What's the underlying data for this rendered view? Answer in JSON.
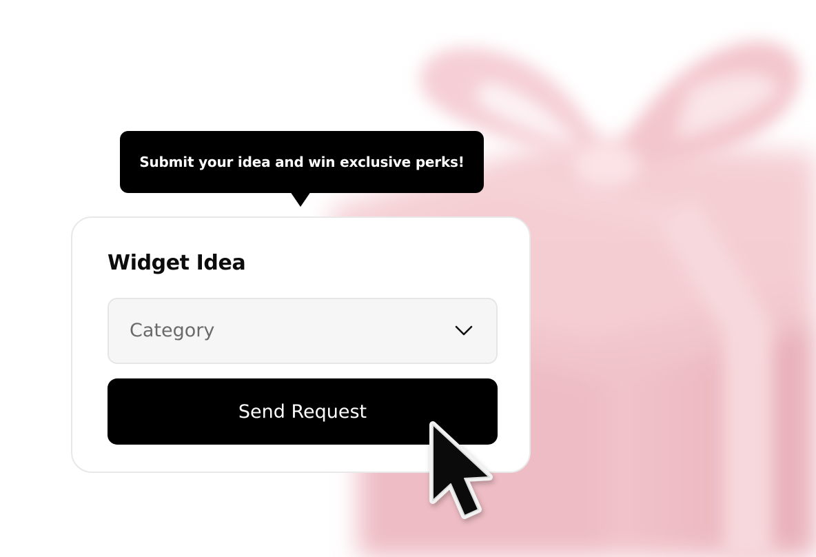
{
  "tooltip": {
    "text": "Submit your idea and win exclusive perks!"
  },
  "form": {
    "title": "Widget Idea",
    "category_select": {
      "value": "Category",
      "icon": "chevron-down-icon"
    },
    "submit_button": {
      "label": "Send Request"
    }
  },
  "background": {
    "illustration": "gift-box",
    "colors": {
      "gift_pink": "#EEB9C2",
      "ribbon_pink": "#F6D3D8"
    }
  },
  "pointer": {
    "icon": "mouse-cursor-icon"
  }
}
